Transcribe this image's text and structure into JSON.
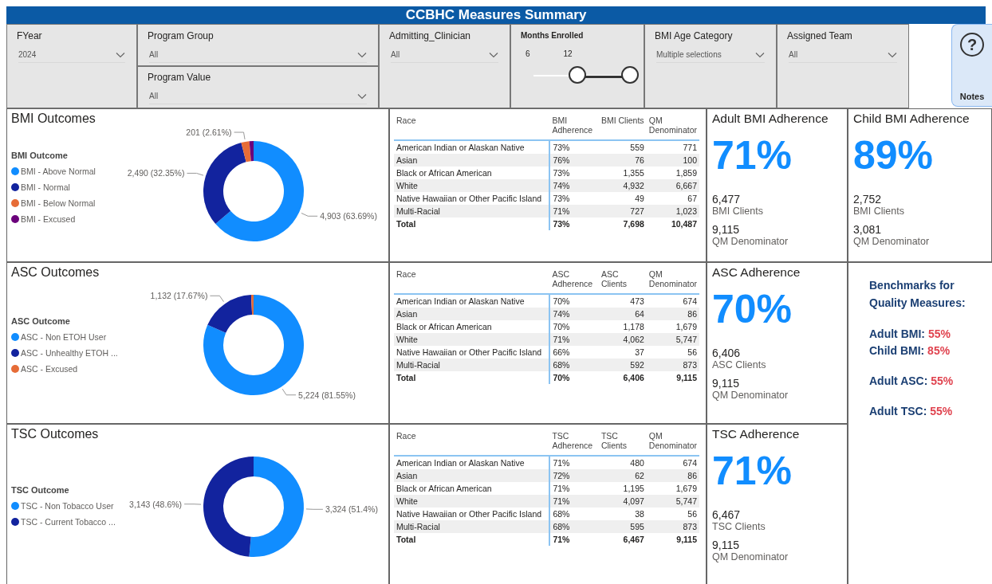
{
  "title": "CCBHC Measures Summary",
  "filters": [
    {
      "slicers": [
        {
          "kind": "dropdown",
          "label": "FYear",
          "value": "2024"
        }
      ]
    },
    {
      "slicers": [
        {
          "kind": "dropdown",
          "label": "Program Group",
          "value": "All"
        },
        {
          "kind": "dropdown",
          "label": "Program Value",
          "value": "All"
        }
      ]
    },
    {
      "slicers": [
        {
          "kind": "dropdown",
          "label": "Admitting_Clinician",
          "value": "All"
        }
      ]
    },
    {
      "slicers": [
        {
          "kind": "range",
          "label": "Months Enrolled",
          "min": "6",
          "max": "12",
          "thumbs": [
            {
              "level": 0.4
            },
            {
              "level": 1
            }
          ]
        }
      ]
    },
    {
      "slicers": [
        {
          "kind": "dropdown",
          "label": "BMI Age Category",
          "value": "Multiple selections"
        }
      ]
    },
    {
      "slicers": [
        {
          "kind": "dropdown",
          "label": "Assigned Team",
          "value": "All"
        }
      ]
    }
  ],
  "notes_button": {
    "icon": "?",
    "label": "Notes"
  },
  "rows": [
    {
      "outcome_panel": {
        "title": "BMI Outcomes",
        "legend_title": "BMI Outcome",
        "chart_data": {
          "type": "donut",
          "categories": [
            "BMI - Above Normal",
            "BMI - Normal",
            "BMI - Below Normal",
            "BMI - Excused"
          ],
          "values": [
            4903,
            2490,
            201,
            104
          ],
          "colors": [
            "#118dff",
            "#12239e",
            "#e66c37",
            "#6b007b"
          ],
          "value_labels": [
            "4,903 (63.69%)",
            "2,490 (32.35%)",
            "201 (2.61%)",
            null
          ]
        }
      },
      "table": {
        "columns": [
          "Race",
          "BMI Adherence",
          "BMI Clients",
          "QM Denominator"
        ],
        "rows": [
          {
            "kind": "data",
            "cells": [
              "American Indian or Alaskan Native",
              "73%",
              "559",
              "771"
            ]
          },
          {
            "kind": "data",
            "cells": [
              "Asian",
              "76%",
              "76",
              "100"
            ]
          },
          {
            "kind": "data",
            "cells": [
              "Black or African American",
              "73%",
              "1,355",
              "1,859"
            ]
          },
          {
            "kind": "data",
            "cells": [
              "White",
              "74%",
              "4,932",
              "6,667"
            ]
          },
          {
            "kind": "data",
            "cells": [
              "Native Hawaiian or Other Pacific Island",
              "73%",
              "49",
              "67"
            ]
          },
          {
            "kind": "data",
            "cells": [
              "Multi-Racial",
              "71%",
              "727",
              "1,023"
            ]
          },
          {
            "kind": "total",
            "cells": [
              "Total",
              "73%",
              "7,698",
              "10,487"
            ]
          }
        ]
      },
      "cards": [
        {
          "kind": "kpi",
          "title": "Adult BMI Adherence",
          "value": "71%",
          "stats": [
            {
              "value": "6,477",
              "label": "BMI Clients"
            },
            {
              "value": "9,115",
              "label": "QM Denominator"
            }
          ]
        },
        {
          "kind": "kpi",
          "title": "Child BMI Adherence",
          "value": "89%",
          "stats": [
            {
              "value": "2,752",
              "label": "BMI Clients"
            },
            {
              "value": "3,081",
              "label": "QM Denominator"
            }
          ]
        }
      ]
    },
    {
      "outcome_panel": {
        "title": "ASC Outcomes",
        "legend_title": "ASC Outcome",
        "chart_data": {
          "type": "donut",
          "categories": [
            "ASC - Non ETOH User",
            "ASC - Unhealthy ETOH ...",
            "ASC - Excused"
          ],
          "values": [
            5224,
            1132,
            50
          ],
          "colors": [
            "#118dff",
            "#12239e",
            "#e66c37"
          ],
          "value_labels": [
            "5,224 (81.55%)",
            "1,132 (17.67%)",
            null
          ]
        }
      },
      "table": {
        "columns": [
          "Race",
          "ASC Adherence",
          "ASC Clients",
          "QM Denominator"
        ],
        "rows": [
          {
            "kind": "data",
            "cells": [
              "American Indian or Alaskan Native",
              "70%",
              "473",
              "674"
            ]
          },
          {
            "kind": "data",
            "cells": [
              "Asian",
              "74%",
              "64",
              "86"
            ]
          },
          {
            "kind": "data",
            "cells": [
              "Black or African American",
              "70%",
              "1,178",
              "1,679"
            ]
          },
          {
            "kind": "data",
            "cells": [
              "White",
              "71%",
              "4,062",
              "5,747"
            ]
          },
          {
            "kind": "data",
            "cells": [
              "Native Hawaiian or Other Pacific Island",
              "66%",
              "37",
              "56"
            ]
          },
          {
            "kind": "data",
            "cells": [
              "Multi-Racial",
              "68%",
              "592",
              "873"
            ]
          },
          {
            "kind": "total",
            "cells": [
              "Total",
              "70%",
              "6,406",
              "9,115"
            ]
          }
        ]
      },
      "cards": [
        {
          "kind": "kpi",
          "title": "ASC Adherence",
          "value": "70%",
          "stats": [
            {
              "value": "6,406",
              "label": "ASC Clients"
            },
            {
              "value": "9,115",
              "label": "QM Denominator"
            }
          ]
        },
        {
          "kind": "benchmarks",
          "title": "Benchmarks for Quality Measures:",
          "groups": [
            [
              {
                "label": "Adult BMI:",
                "value": "55%"
              },
              {
                "label": "Child BMI:",
                "value": "85%"
              }
            ],
            [
              {
                "label": "Adult ASC:",
                "value": "55%"
              }
            ],
            [
              {
                "label": "Adult TSC:",
                "value": "55%"
              }
            ]
          ]
        }
      ]
    },
    {
      "outcome_panel": {
        "title": "TSC Outcomes",
        "legend_title": "TSC Outcome",
        "chart_data": {
          "type": "donut",
          "categories": [
            "TSC - Non Tobacco User",
            "TSC - Current Tobacco ..."
          ],
          "values": [
            3324,
            3143
          ],
          "colors": [
            "#118dff",
            "#12239e"
          ],
          "value_labels": [
            "3,324 (51.4%)",
            "3,143 (48.6%)"
          ]
        }
      },
      "table": {
        "columns": [
          "Race",
          "TSC Adherence",
          "TSC Clients",
          "QM Denominator"
        ],
        "rows": [
          {
            "kind": "data",
            "cells": [
              "American Indian or Alaskan Native",
              "71%",
              "480",
              "674"
            ]
          },
          {
            "kind": "data",
            "cells": [
              "Asian",
              "72%",
              "62",
              "86"
            ]
          },
          {
            "kind": "data",
            "cells": [
              "Black or African American",
              "71%",
              "1,195",
              "1,679"
            ]
          },
          {
            "kind": "data",
            "cells": [
              "White",
              "71%",
              "4,097",
              "5,747"
            ]
          },
          {
            "kind": "data",
            "cells": [
              "Native Hawaiian or Other Pacific Island",
              "68%",
              "38",
              "56"
            ]
          },
          {
            "kind": "data",
            "cells": [
              "Multi-Racial",
              "68%",
              "595",
              "873"
            ]
          },
          {
            "kind": "total",
            "cells": [
              "Total",
              "71%",
              "6,467",
              "9,115"
            ]
          }
        ]
      },
      "cards": [
        {
          "kind": "kpi",
          "title": "TSC Adherence",
          "value": "71%",
          "stats": [
            {
              "value": "6,467",
              "label": "TSC Clients"
            },
            {
              "value": "9,115",
              "label": "QM Denominator"
            }
          ]
        }
      ]
    }
  ]
}
